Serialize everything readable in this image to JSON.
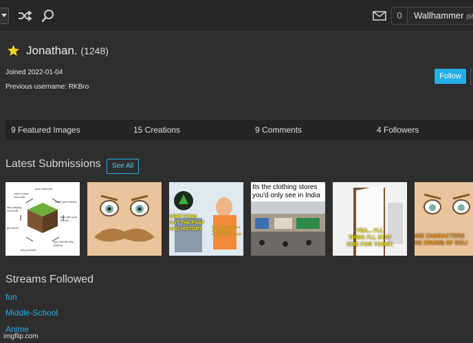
{
  "topbar": {
    "notification_count": "0",
    "user_button_label": "Wallhammer",
    "user_button_points": "(65",
    "icons": [
      "menu-caret-icon",
      "shuffle-icon",
      "search-icon",
      "mail-icon"
    ]
  },
  "profile": {
    "username": "Jonathan.",
    "points": "(1248)",
    "joined": "Joined 2022-01-04",
    "previous_username": "Previous username: RKBro",
    "follow_label": "Follow"
  },
  "stats": {
    "featured": "9 Featured Images",
    "creations": "15 Creations",
    "comments": "9 Comments",
    "followers": "4 Followers"
  },
  "submissions": {
    "title": "Latest Submissions",
    "see_all_label": "See All",
    "items": [
      {
        "caption_lines": [
          "want to play minecraft",
          "play minecraft",
          "invite your friends",
          "stop playing minecraft",
          "play with your friends",
          "get bored",
          "your friends stop playing",
          "play yourself"
        ]
      },
      {
        "caption_lines": []
      },
      {
        "caption_lines": [
          "VERYTHING",
          "OUT THE FNAF",
          "AND HISTORY",
          "NO MORE JUST WANTS",
          "CHECK IN AFTER",
          "THE COMMUNITY AFTER"
        ]
      },
      {
        "caption_lines": [
          "Its the clothing stores",
          "you'd only see in India"
        ]
      },
      {
        "caption_lines": [
          "YEA... I'LL",
          "THINK I'LL STAY",
          "OME FOR TODAY."
        ]
      },
      {
        "caption_lines": [
          "IME CHARACTERS",
          "NE CRUMB OF DELI"
        ]
      }
    ]
  },
  "streams": {
    "title": "Streams Followed",
    "items": [
      "fun",
      "Middle-School",
      "Anime"
    ]
  },
  "watermark": "imgflip.com",
  "colors": {
    "accent": "#22aee6",
    "background": "#2e2e2e",
    "topbar": "#262626",
    "star": "#f2d21c"
  }
}
